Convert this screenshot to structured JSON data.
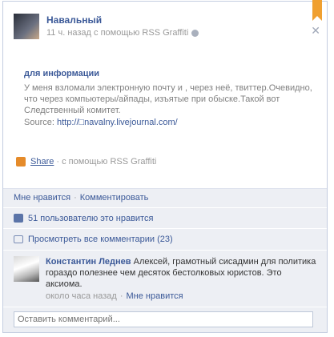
{
  "post": {
    "author": "Навальный",
    "meta": "11 ч. назад с помощью RSS Graffiti",
    "title": "для информации",
    "text": "У меня взломали электронную почту и , через неё, твиттер.Очевидно, что через компьютеры/айпады, изъятые при обыске.Такой вот Следственный комитет.",
    "source_label": "Source:",
    "source_link": "http://□navalny.livejournal.com/",
    "share_label": "Share",
    "share_via": "· с помощью RSS Graffiti"
  },
  "actions": {
    "like": "Мне нравится",
    "comment": "Комментировать"
  },
  "likes": {
    "text": "51 пользователю это нравится"
  },
  "view_comments": {
    "text": "Просмотреть все комментарии (23)"
  },
  "comment": {
    "author": "Константин Леднев",
    "text": "Алексей, грамотный сисадмин для политика гораздо полезнее чем десяток бестолковых юристов. Это аксиома.",
    "time": "около часа назад",
    "like": "Мне нравится"
  },
  "input": {
    "placeholder": "Оставить комментарий..."
  },
  "colors": {
    "link": "#3b5998",
    "panel": "#edeff4",
    "bookmark": "#f0a030"
  }
}
